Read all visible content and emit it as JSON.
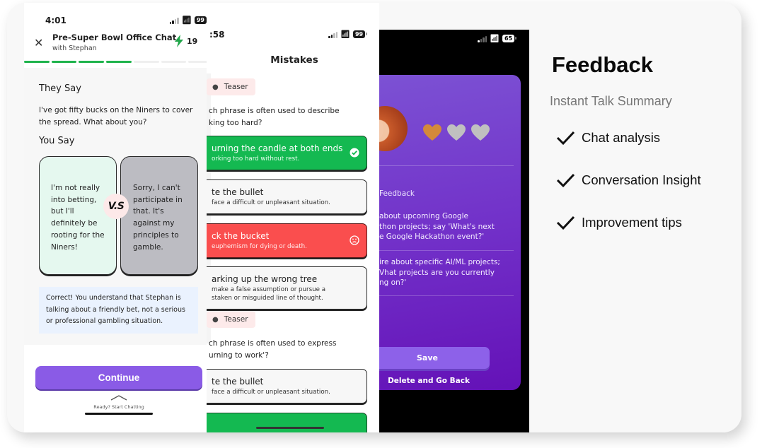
{
  "phone1": {
    "status": {
      "time": "4:01",
      "battery": "99"
    },
    "header": {
      "title": "Pre-Super Bowl Office Chat",
      "subtitle": "with Stephan",
      "energy_count": "19"
    },
    "progress": {
      "completed_steps": 4,
      "total_steps": 7
    },
    "they_say_heading": "They Say",
    "they_say_text": "I've got fifty bucks on the Niners to cover the spread. What about you?",
    "you_say_heading": "You Say",
    "choices": [
      {
        "text": "I'm not really into betting, but I'll definitely be rooting for the Niners!"
      },
      {
        "text": "Sorry, I can't participate in that. It's against my principles to gamble."
      }
    ],
    "vs_label": "V.S",
    "verdict": "Correct! You understand that Stephan is talking about a friendly bet, not a serious or professional gambling situation.",
    "continue_label": "Continue",
    "swipe_hint": "Ready? Start Chatting"
  },
  "phone2": {
    "status": {
      "time": ":58",
      "battery": "99"
    },
    "title": "Mistakes",
    "sections": [
      {
        "tag": "Teaser",
        "question": "ch phrase is often used to describe\nking too hard?",
        "options": [
          {
            "title": "urning the candle at both ends",
            "subtitle": "orking too hard without rest.",
            "state": "correct"
          },
          {
            "title": "te the bullet",
            "subtitle": " face a difficult or unpleasant situation.",
            "state": "neutral"
          },
          {
            "title": "ck the bucket",
            "subtitle": "euphemism for dying or death.",
            "state": "wrong"
          },
          {
            "title": "arking up the wrong tree",
            "subtitle": " make a false assumption or pursue a\nstaken or misguided line of thought.",
            "state": "neutral"
          }
        ]
      },
      {
        "tag": "Teaser",
        "question": "ch phrase is often used to express\nurning to work'?",
        "options": [
          {
            "title": "te the bullet",
            "subtitle": " face a difficult or unpleasant situation.",
            "state": "neutral"
          }
        ]
      }
    ]
  },
  "phone3": {
    "status": {
      "battery": "65"
    },
    "hearts": {
      "filled": 1,
      "total": 3
    },
    "feedback_label": "Feedback",
    "tips": [
      "about upcoming Google\nthon projects; say 'What's next\ne Google Hackathon event?'",
      "ire about specific AI/ML projects;\nVhat projects are you currently\nng on?'"
    ],
    "save_label": "Save",
    "delete_label": "Delete and Go Back"
  },
  "features": {
    "title": "Feedback",
    "subtitle": "Instant Talk Summary",
    "items": [
      "Chat analysis",
      "Conversation Insight",
      "Improvement tips"
    ]
  },
  "colors": {
    "brand_purple": "#8a5be6",
    "success_green": "#14b951",
    "error_red": "#fa4e4e",
    "progress_green": "#1fb34c",
    "heart_filled": "#d4893a",
    "heart_empty": "#c0c0c0"
  }
}
